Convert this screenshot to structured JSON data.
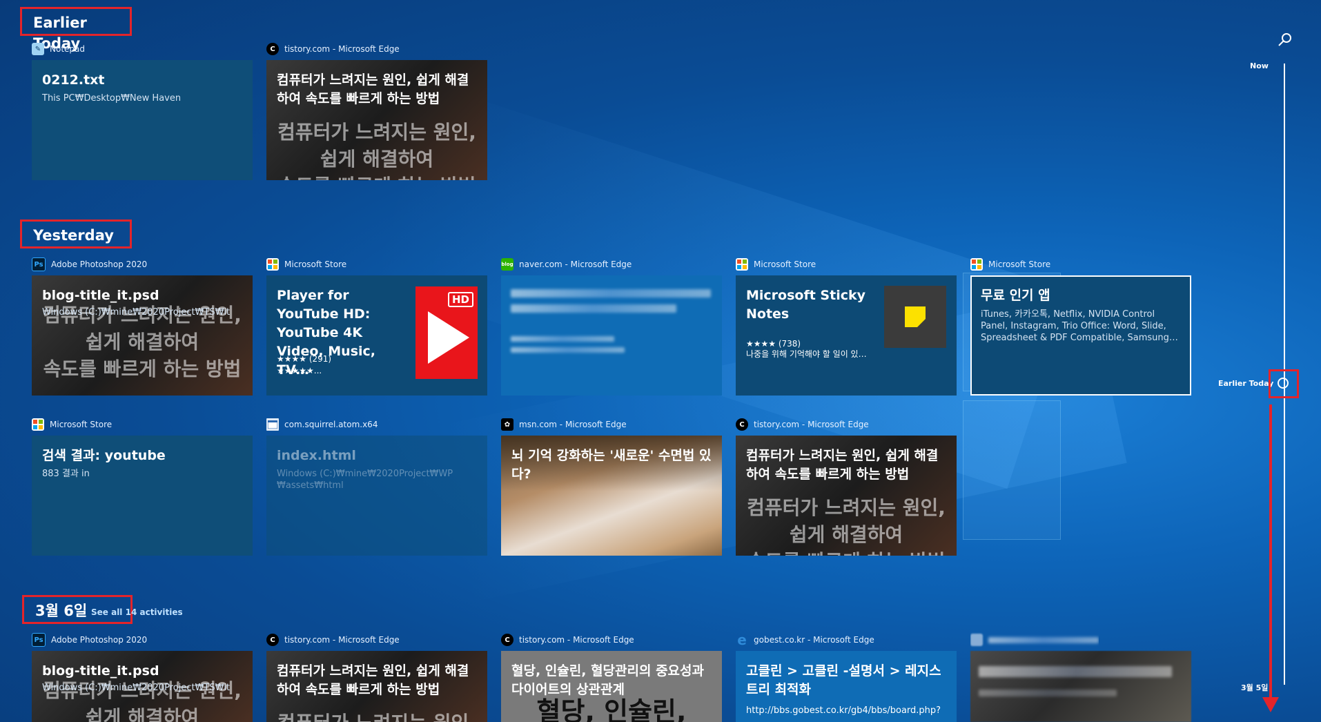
{
  "sections": {
    "earlier_today": "Earlier Today",
    "yesterday": "Yesterday",
    "mar6": "3월 6일",
    "mar6_see_all": "See all 14 activities"
  },
  "cards": {
    "c1": {
      "app": "Notepad",
      "title": "0212.txt",
      "subtitle": "This PC₩Desktop₩New Haven"
    },
    "c2": {
      "app": "tistory.com - Microsoft Edge",
      "title": "컴퓨터가 느려지는 원인, 쉽게 해결하여 속도를 빠르게 하는 방법",
      "bg1": "컴퓨터가 느려지는 원인,",
      "bg2": "쉽게 해결하여",
      "bg3": "속도를 빠르게 하는 방법"
    },
    "c3": {
      "app": "Adobe Photoshop 2020",
      "title": "blog-title_it.psd",
      "subtitle": "Windows (C:)₩mine₩2020Project₩TS₩it",
      "bg1": "컴퓨터가 느려지는 원인,",
      "bg2": "쉽게 해결하여",
      "bg3": "속도를 빠르게 하는 방법"
    },
    "c4": {
      "app": "Microsoft Store",
      "title": "Player for YouTube HD: YouTube 4K Video, Music, TV…",
      "rating": "★★★★ (291)",
      "rating2": "★★★★★...",
      "badge": "HD"
    },
    "c5": {
      "app": "naver.com - Microsoft Edge"
    },
    "c6": {
      "app": "Microsoft Store",
      "title": "Microsoft Sticky Notes",
      "rating": "★★★★ (738)",
      "desc": "나중을 위해 기억해야 할 일이 있…"
    },
    "c7": {
      "app": "Microsoft Store",
      "title": "무료 인기 앱",
      "desc": "iTunes, 카카오톡, Netflix, NVIDIA Control Panel, Instagram, Trio Office: Word, Slide, Spreadsheet & PDF Compatible, Samsung…"
    },
    "c8": {
      "app": "Microsoft Store",
      "title": "검색 결과: youtube",
      "subtitle": "883 결과 in"
    },
    "c9": {
      "app": "com.squirrel.atom.x64",
      "title": "index.html",
      "subtitle": "Windows (C:)₩mine₩2020Project₩WP ₩assets₩html"
    },
    "c10": {
      "app": "msn.com - Microsoft Edge",
      "title": "뇌 기억 강화하는 '새로운' 수면법 있다?"
    },
    "c11": {
      "app": "tistory.com - Microsoft Edge",
      "title": "컴퓨터가 느려지는 원인, 쉽게 해결하여 속도를 빠르게 하는 방법",
      "bg1": "컴퓨터가 느려지는 원인,",
      "bg2": "쉽게 해결하여",
      "bg3": "속도를 빠르게 하는 방법"
    },
    "c12": {
      "app": "Adobe Photoshop 2020",
      "title": "blog-title_it.psd",
      "subtitle": "Windows (C:)₩mine₩2020Project₩TS₩it",
      "bg1": "컴퓨터가 느려지는 원인,",
      "bg2": "쉽게 해결하여"
    },
    "c13": {
      "app": "tistory.com - Microsoft Edge",
      "title": "컴퓨터가 느려지는 원인, 쉽게 해결하여 속도를 빠르게 하는 방법",
      "bg1": "컴퓨터가 느려지는 원인,"
    },
    "c14": {
      "app": "tistory.com - Microsoft Edge",
      "title": "혈당, 인슐린, 혈당관리의 중요성과 다이어트의 상관관계",
      "bg1": "혈당, 인슐린,"
    },
    "c15": {
      "app": "gobest.co.kr - Microsoft Edge",
      "title": "고클린 > 고클린 -설명서 > 레지스트리 최적화",
      "url": "http://bbs.gobest.co.kr/gb4/bbs/board.php?"
    }
  },
  "timeline": {
    "now": "Now",
    "earlier_today": "Earlier Today",
    "mar5": "3월 5일"
  },
  "colors": {
    "highlight": "#e4242a",
    "background": "#0d64b8"
  }
}
